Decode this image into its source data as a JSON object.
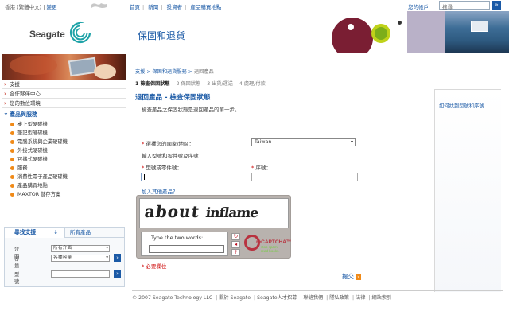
{
  "topbar": {
    "region_label": "香港 (繁體中文)",
    "region_change": "變更",
    "nav": [
      "首頁",
      "新聞",
      "投資者",
      "產品購買地點"
    ],
    "account": "您的帳戶",
    "search_value": "搜尋",
    "search_button": "»"
  },
  "logo": {
    "word": "Seagate"
  },
  "leftnav": {
    "main": [
      "支援",
      "合作夥伴中心",
      "您的數位環境"
    ],
    "section_title": "產品與服務",
    "sub": [
      "桌上型硬碟機",
      "筆記型硬碟機",
      "電腦系統與企業硬碟機",
      "外接式硬碟機",
      "可攜式硬碟機",
      "服務",
      "消費性電子產品硬碟機",
      "產品購買地點",
      "MAXTOR 儲存方案"
    ]
  },
  "supportbox": {
    "tab1": "尋找支援",
    "tab1_arrow": "↓",
    "tab2": "所有產品",
    "row1_label": "介面",
    "row1_value": "所有介面",
    "row2_label": "容量",
    "row2_value": "各種容量",
    "row3_label": "型號",
    "go": "›"
  },
  "banner": {
    "title": "保固和退貨"
  },
  "main": {
    "breadcrumb": [
      "支援",
      "保固和退貨服務",
      "退回產品"
    ],
    "breadcrumb_sep": " > ",
    "steps": [
      "1 檢查保固狀態",
      "2 保固狀態",
      "3 出貨/運送",
      "4 處理/付款"
    ],
    "heading": "退回產品 - 檢查保固狀態",
    "intro": "檢查產品之保固狀態是退回產品的第一步。",
    "country_label": "選擇您的國家/地區：",
    "country_value": "Taiwan",
    "enter_label": "輸入型號和零件號及序號",
    "model_label": "型號或零件號：",
    "serial_label": "序號：",
    "add_more": "加入其他產品？",
    "required_mark": "*",
    "required_text": "必要欄位",
    "submit": "提交",
    "submit_arrow": "›"
  },
  "captcha": {
    "word1": "about",
    "word2": "inflame",
    "prompt": "Type the two words:",
    "refresh_icon": "↻",
    "audio_icon": "◂",
    "help_icon": "?",
    "brand": "reCAPTCHA™",
    "tagline1": "stop spam.",
    "tagline2": "read books."
  },
  "rightbox": {
    "link": "如何找到型號和序號"
  },
  "footer": {
    "copyright": "© 2007 Seagate Technology LLC",
    "links": [
      "關於 Seagate",
      "Seagate人才招募",
      "聯絡我們",
      "隱私政策",
      "法律",
      "網站索引"
    ]
  },
  "colors": {
    "brand_blue": "#1b5aa6",
    "accent_orange": "#f08a18",
    "required_red": "#cc0000"
  }
}
